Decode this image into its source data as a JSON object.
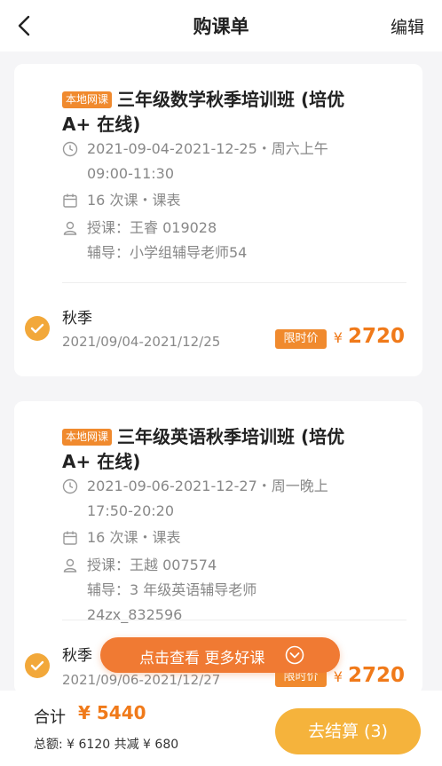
{
  "header": {
    "title": "购课单",
    "edit_label": "编辑",
    "back_icon": "chevron-left-icon"
  },
  "courses": [
    {
      "tag": "本地网课",
      "title": "三年级数学秋季培训班 (培优 A+ 在线)",
      "schedule_line1": "2021-09-04-2021-12-25・周六上午",
      "schedule_line2": "09:00-11:30",
      "lessons": "16 次课・课表",
      "teacher": "授课：王睿 019028",
      "tutor": "辅导：小学组辅导老师54",
      "term": "秋季",
      "term_dates": "2021/09/04-2021/12/25",
      "limited_label": "限时价",
      "currency": "¥",
      "price": "2720",
      "selected": true
    },
    {
      "tag": "本地网课",
      "title": "三年级英语秋季培训班 (培优 A+ 在线)",
      "schedule_line1": "2021-09-06-2021-12-27・周一晚上",
      "schedule_line2": "17:50-20:20",
      "lessons": "16 次课・课表",
      "teacher": "授课：王越 007574",
      "tutor_line1": "辅导：3 年级英语辅导老师",
      "tutor_line2": "24zx_832596",
      "term": "秋季",
      "term_dates": "2021/09/06-2021/12/27",
      "limited_label": "限时价",
      "currency": "¥",
      "price": "2720",
      "selected": true
    }
  ],
  "more_button": {
    "label": "点击查看 更多好课"
  },
  "summary": {
    "total_label": "合计",
    "total_amount": "¥ 5440",
    "breakdown": "总额: ¥ 6120  共减 ¥ 680",
    "checkout_label": "去结算 (3)"
  },
  "colors": {
    "accent": "#f07a1a",
    "tag": "#f08a2e",
    "check": "#f2a83a",
    "checkout": "#f5b33c"
  }
}
